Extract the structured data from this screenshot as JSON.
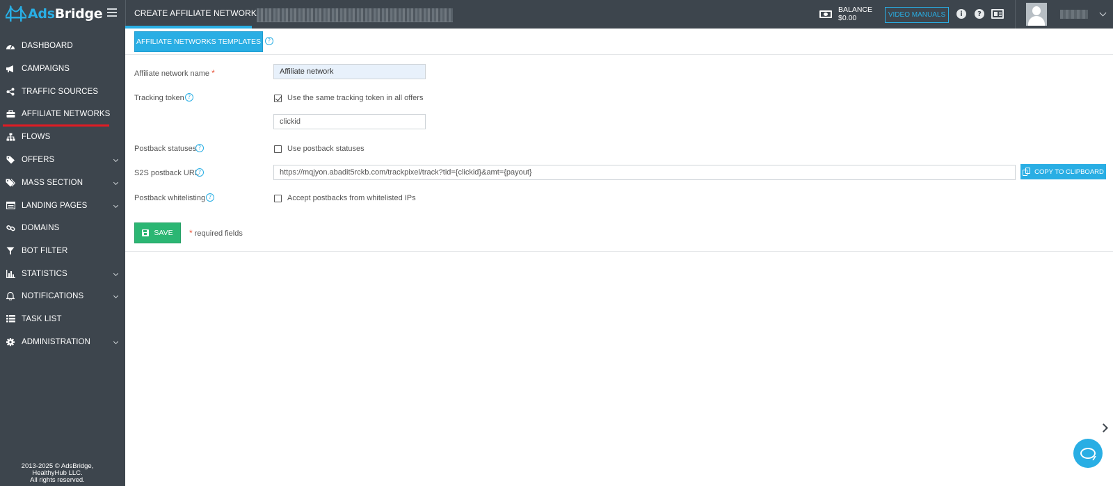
{
  "app": {
    "logo_ads": "Ads",
    "logo_bridge": "Bridge",
    "page_title": "CREATE AFFILIATE NETWORK"
  },
  "header": {
    "balance_label": "BALANCE",
    "balance_value": "$0.00",
    "video_manuals": "VIDEO MANUALS",
    "info_icon": "i",
    "help_icon": "?"
  },
  "sidebar": {
    "items": [
      {
        "label": "DASHBOARD",
        "icon": "dashboard-icon",
        "has_submenu": false
      },
      {
        "label": "CAMPAIGNS",
        "icon": "megaphone-icon",
        "has_submenu": false
      },
      {
        "label": "TRAFFIC SOURCES",
        "icon": "share-icon",
        "has_submenu": false
      },
      {
        "label": "AFFILIATE NETWORKS",
        "icon": "briefcase-icon",
        "has_submenu": false,
        "active": true
      },
      {
        "label": "FLOWS",
        "icon": "sitemap-icon",
        "has_submenu": false
      },
      {
        "label": "OFFERS",
        "icon": "tag-icon",
        "has_submenu": true
      },
      {
        "label": "MASS SECTION",
        "icon": "tags-icon",
        "has_submenu": true
      },
      {
        "label": "LANDING PAGES",
        "icon": "landing-icon",
        "has_submenu": true
      },
      {
        "label": "DOMAINS",
        "icon": "link-icon",
        "has_submenu": false
      },
      {
        "label": "BOT FILTER",
        "icon": "filter-icon",
        "has_submenu": false
      },
      {
        "label": "STATISTICS",
        "icon": "bar-chart-icon",
        "has_submenu": true
      },
      {
        "label": "NOTIFICATIONS",
        "icon": "bell-icon",
        "has_submenu": true
      },
      {
        "label": "TASK LIST",
        "icon": "task-list-icon",
        "has_submenu": false
      },
      {
        "label": "ADMINISTRATION",
        "icon": "gear-icon",
        "has_submenu": true
      }
    ],
    "copyright_1": "2013-2025 © AdsBridge,",
    "copyright_2": "HealthyHub LLC.",
    "copyright_3": "All rights reserved."
  },
  "form": {
    "templates_button": "AFFILIATE NETWORKS TEMPLATES",
    "help_glyph": "?",
    "name_label": "Affiliate network name",
    "required_star": "*",
    "name_value": "Affiliate network",
    "tracking_label": "Tracking token",
    "same_token_label": "Use the same tracking token in all offers",
    "same_token_checked": true,
    "token_value": "clickid",
    "postback_statuses_label": "Postback statuses",
    "use_postback_label": "Use postback statuses",
    "use_postback_checked": false,
    "s2s_label": "S2S postback URL",
    "s2s_value": "https://mqjyon.abadit5rckb.com/trackpixel/track?tid={clickid}&amt={payout}",
    "copy_button": "COPY TO CLIPBOARD",
    "whitelist_label": "Postback whitelisting",
    "accept_whitelist_label": "Accept postbacks from whitelisted IPs",
    "accept_whitelist_checked": false,
    "save_button": "SAVE",
    "required_note": "required fields"
  },
  "colors": {
    "sidebar_bg": "#3d454d",
    "accent": "#29aee4",
    "save": "#2bb673",
    "active_underline": "#e21b23"
  }
}
